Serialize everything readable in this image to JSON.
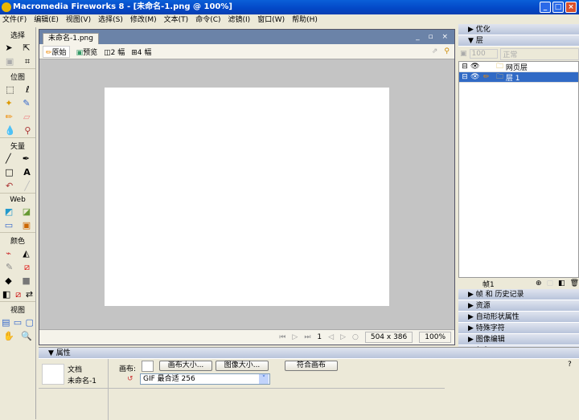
{
  "window": {
    "title": "Macromedia Fireworks 8 - [未命名-1.png @ 100%]",
    "min": "_",
    "max": "□",
    "close": "×"
  },
  "menu": [
    "文件(F)",
    "编辑(E)",
    "视图(V)",
    "选择(S)",
    "修改(M)",
    "文本(T)",
    "命令(C)",
    "滤镜(I)",
    "窗口(W)",
    "帮助(H)"
  ],
  "tools": {
    "sections": [
      "选择",
      "位图",
      "矢量",
      "Web",
      "颜色",
      "视图"
    ]
  },
  "document": {
    "tab": "未命名-1.png",
    "views": [
      "原始",
      "预览",
      "2 幅",
      "4 幅"
    ],
    "frame": "1",
    "size": "504 x 386",
    "zoom": "100%"
  },
  "panels": {
    "optimize": "优化",
    "layers": "层",
    "opacity": "100",
    "blend": "正常",
    "layer_rows": [
      "网页层",
      "层 1"
    ],
    "frame_label": "帧1",
    "collapsed": [
      "帧 和 历史记录",
      "资源",
      "自动形状属性",
      "特殊字符",
      "图像编辑",
      "颜色"
    ]
  },
  "properties": {
    "title": "属性",
    "doc_label": "文档",
    "doc_name": "未命名-1",
    "canvas_label": "画布:",
    "canvas_size": "画布大小...",
    "image_size": "图像大小...",
    "fit_canvas": "符合画布",
    "format": "GIF 最合适 256",
    "help": "?"
  }
}
